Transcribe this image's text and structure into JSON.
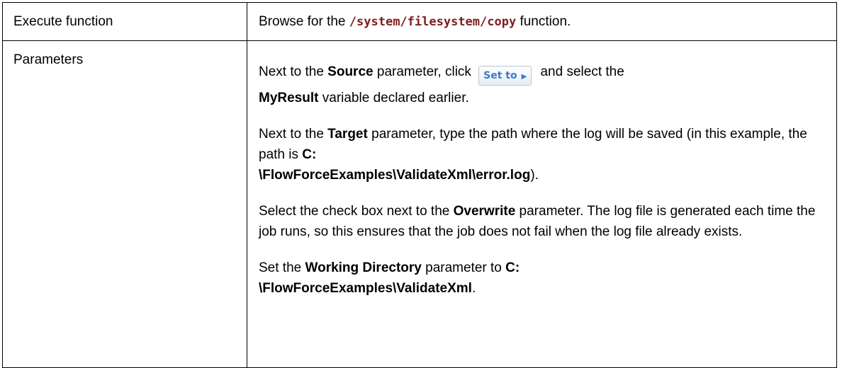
{
  "rows": [
    {
      "label": "Execute function",
      "content": {
        "prefix": "Browse for the ",
        "code": "/system/filesystem/copy",
        "suffix": " function."
      }
    },
    {
      "label": "Parameters",
      "p1": {
        "t1": "Next to the ",
        "b1": "Source",
        "t2": " parameter, click ",
        "button": "Set to",
        "t3": " and select the ",
        "b2": "MyResult",
        "t4": " variable declared earlier."
      },
      "p2": {
        "t1": "Next to the ",
        "b1": "Target",
        "t2": " parameter, type the path where the log will be saved (in this example, the path is ",
        "b2a": "C:",
        "b2b": "\\FlowForceExamples\\ValidateXml\\error.log",
        "t3": ")."
      },
      "p3": {
        "t1": "Select the check box next to the ",
        "b1": "Overwrite",
        "t2": " parameter. The log file is generated each time the job runs, so this ensures that the job does not fail when the log file already exists."
      },
      "p4": {
        "t1": "Set the ",
        "b1": "Working Directory",
        "t2": " parameter to ",
        "b2a": "C:",
        "b2b": "\\FlowForceExamples\\ValidateXml",
        "t3": "."
      }
    }
  ]
}
